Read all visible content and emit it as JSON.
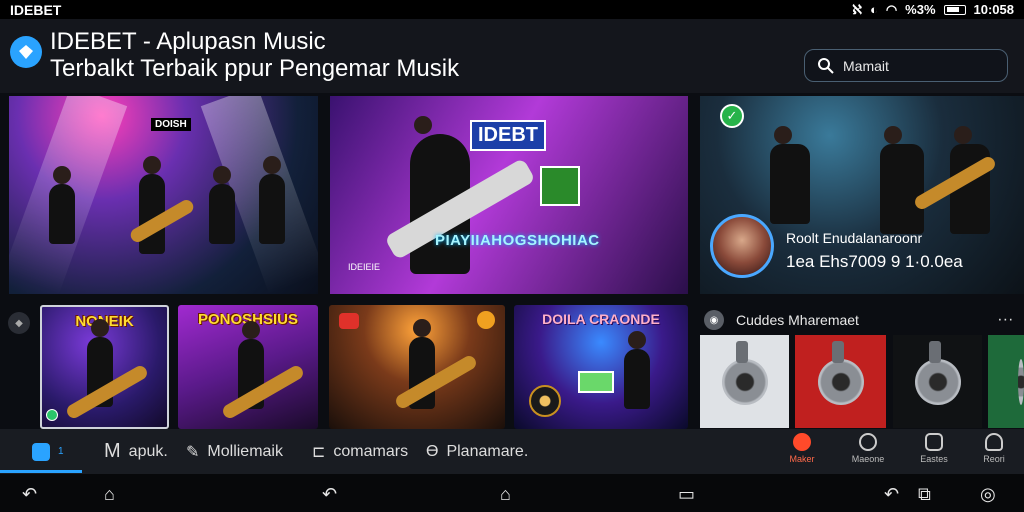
{
  "status": {
    "app_name": "IDEBET",
    "battery": "%3%",
    "time": "10:058"
  },
  "header": {
    "title_line1": "IDEBET - Aplupasn Music",
    "title_line2": "Terbalkt Terbaik ppur Pengemar Musik",
    "search_placeholder": "Mamait"
  },
  "banners": [
    {
      "sign": "DOISH"
    },
    {
      "logo": "IDEBT",
      "headline": "PIAYIIAHOGSHOHIAC",
      "label": "IDEIEIE"
    },
    {
      "name": "Roolt Enudalanaroonr",
      "stats": "1ea Ehs7009  9   1·0.0ea"
    }
  ],
  "cards": [
    {
      "title": "NONEIK"
    },
    {
      "title": "PONOSHSIUS"
    },
    {
      "title": ""
    },
    {
      "title": "DOILA CRAONDE"
    }
  ],
  "section": {
    "title": "Cuddes Mharemaet",
    "more": "∙∙∙"
  },
  "tabs": [
    {
      "label": "1"
    },
    {
      "label": "apuk.",
      "icon": "M"
    },
    {
      "label": "Molliemaik"
    },
    {
      "label": "comamars"
    },
    {
      "label": "Planamare.",
      "icon": "Ɵ"
    }
  ],
  "right_tabs": [
    {
      "label": "Maker"
    },
    {
      "label": "Maeone"
    },
    {
      "label": "Eastes"
    },
    {
      "label": "Reori"
    }
  ],
  "colors": {
    "accent": "#2aa3ff",
    "active_tab": "#ff4a2a"
  }
}
